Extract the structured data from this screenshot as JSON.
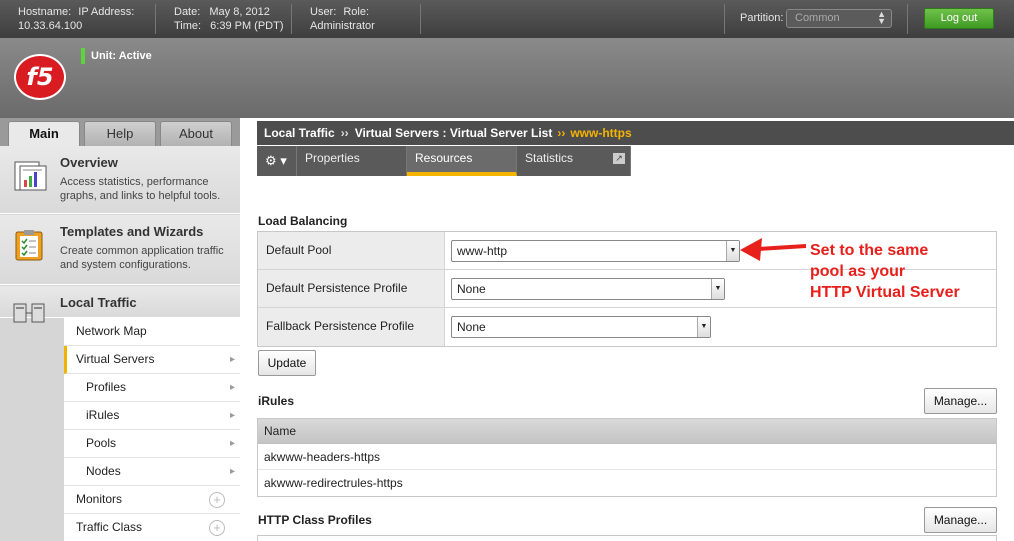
{
  "topbar": {
    "hostname_label": "Hostname:",
    "hostname_value": "10.33.64.100",
    "ip_label": "IP Address:",
    "date_label": "Date:",
    "date_value": "May 8, 2012",
    "time_label": "Time:",
    "time_value": "6:39 PM (PDT)",
    "user_label": "User:",
    "role_label": "Role:",
    "role_value": "Administrator",
    "partition_label": "Partition:",
    "partition_value": "Common",
    "logout_label": "Log out"
  },
  "header": {
    "logo_text": "f5",
    "unit_status": "Unit: Active"
  },
  "nav_tabs": [
    "Main",
    "Help",
    "About"
  ],
  "sections": [
    {
      "title": "Overview",
      "desc": "Access statistics, performance graphs, and links to helpful tools."
    },
    {
      "title": "Templates and Wizards",
      "desc": "Create common application traffic and system configurations."
    },
    {
      "title": "Local Traffic",
      "desc": ""
    }
  ],
  "nav_items": [
    {
      "label": "Network Map"
    },
    {
      "label": "Virtual Servers"
    },
    {
      "label": "Profiles"
    },
    {
      "label": "iRules"
    },
    {
      "label": "Pools"
    },
    {
      "label": "Nodes"
    },
    {
      "label": "Monitors"
    },
    {
      "label": "Traffic Class"
    }
  ],
  "breadcrumb": {
    "part1": "Local Traffic",
    "sep1": "››",
    "part2": "Virtual Servers : Virtual Server List",
    "sep2": "››",
    "current": "www-https"
  },
  "subtabs": [
    "Properties",
    "Resources",
    "Statistics"
  ],
  "load_balancing": {
    "title": "Load Balancing",
    "rows": [
      {
        "label": "Default Pool",
        "value": "www-http"
      },
      {
        "label": "Default Persistence Profile",
        "value": "None"
      },
      {
        "label": "Fallback Persistence Profile",
        "value": "None"
      }
    ],
    "update_label": "Update"
  },
  "irules": {
    "title": "iRules",
    "manage_label": "Manage...",
    "column": "Name",
    "rows": [
      "akwww-headers-https",
      "akwww-redirectrules-https"
    ]
  },
  "http_class": {
    "title": "HTTP Class Profiles",
    "manage_label": "Manage..."
  },
  "annotation": {
    "line1": "Set to the same",
    "line2": "pool as your",
    "line3": "HTTP Virtual Server",
    "color": "#e8201c"
  },
  "colors": {
    "accent": "#f5b400",
    "logout": "#4aa82c",
    "brand": "#d81c22"
  }
}
